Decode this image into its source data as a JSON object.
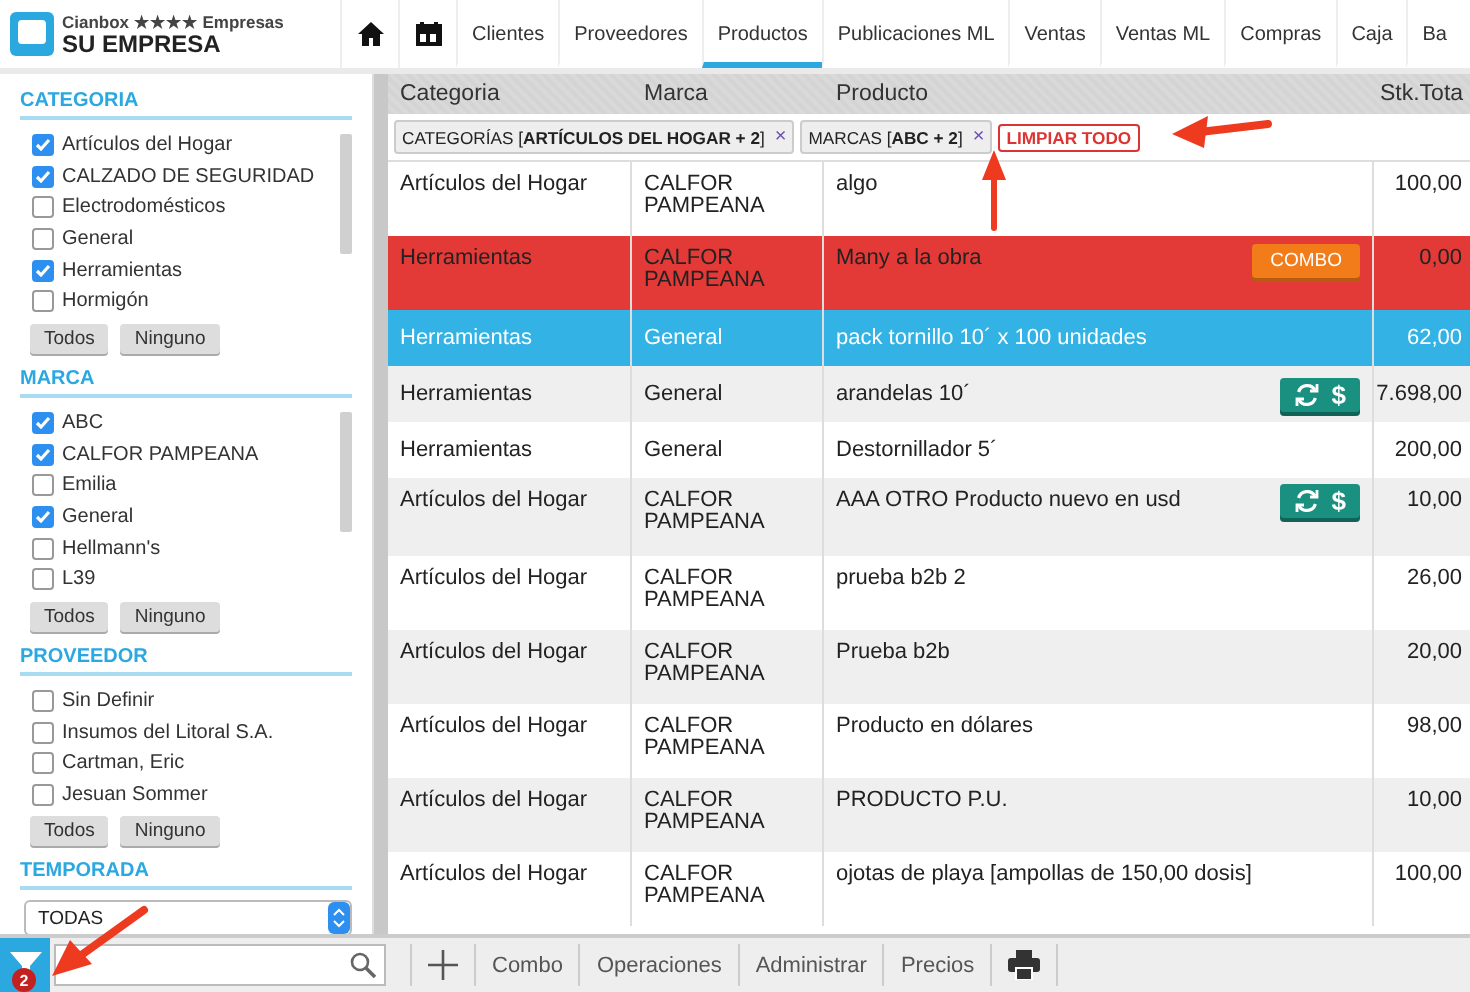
{
  "header": {
    "brand_line": "Cianbox ★★★★ Empresas",
    "company": "SU EMPRESA",
    "tabs": [
      {
        "label": "Clientes",
        "selected": false
      },
      {
        "label": "Proveedores",
        "selected": false
      },
      {
        "label": "Productos",
        "selected": true
      },
      {
        "label": "Publicaciones ML",
        "selected": false
      },
      {
        "label": "Ventas",
        "selected": false
      },
      {
        "label": "Ventas ML",
        "selected": false
      },
      {
        "label": "Compras",
        "selected": false
      },
      {
        "label": "Caja",
        "selected": false
      },
      {
        "label": "Ba",
        "selected": false
      }
    ]
  },
  "sidebar": {
    "sections": [
      {
        "kind": "checklist",
        "title": "CATEGORIA",
        "items": [
          {
            "label": "Artículos del Hogar",
            "checked": true
          },
          {
            "label": "CALZADO DE SEGURIDAD",
            "checked": true
          },
          {
            "label": "Electrodomésticos",
            "checked": false
          },
          {
            "label": "General",
            "checked": false
          },
          {
            "label": "Herramientas",
            "checked": true
          },
          {
            "label": "Hormigón",
            "checked": false
          }
        ],
        "buttons": [
          "Todos",
          "Ninguno"
        ],
        "scrollable": true
      },
      {
        "kind": "checklist",
        "title": "MARCA",
        "items": [
          {
            "label": "ABC",
            "checked": true
          },
          {
            "label": "CALFOR PAMPEANA",
            "checked": true
          },
          {
            "label": "Emilia",
            "checked": false
          },
          {
            "label": "General",
            "checked": true
          },
          {
            "label": "Hellmann's",
            "checked": false
          },
          {
            "label": "L39",
            "checked": false
          }
        ],
        "buttons": [
          "Todos",
          "Ninguno"
        ],
        "scrollable": true
      },
      {
        "kind": "checklist",
        "title": "PROVEEDOR",
        "items": [
          {
            "label": "Sin Definir",
            "checked": false
          },
          {
            "label": "Insumos del Litoral S.A.",
            "checked": false
          },
          {
            "label": "Cartman, Eric",
            "checked": false
          },
          {
            "label": "Jesuan Sommer",
            "checked": false
          }
        ],
        "buttons": [
          "Todos",
          "Ninguno"
        ],
        "scrollable": false
      },
      {
        "kind": "select",
        "title": "TEMPORADA",
        "value": "TODAS"
      }
    ]
  },
  "table": {
    "columns": [
      "Categoria",
      "Marca",
      "Producto",
      "Stk.Tota"
    ],
    "filters": [
      {
        "text": "CATEGORÍAS [**ARTÍCULOS DEL HOGAR + 2**]",
        "remove": "×"
      },
      {
        "text": "MARCAS [**ABC + 2**]",
        "remove": "×"
      }
    ],
    "clear_all": "LIMPIAR TODO",
    "rows": [
      {
        "cells": [
          "Artículos del Hogar",
          "CALFOR PAMPEANA",
          "algo",
          "100,00"
        ],
        "alert": false,
        "selected": false
      },
      {
        "cells": [
          "Herramientas",
          "CALFOR PAMPEANA",
          "Many a la obra",
          "0,00"
        ],
        "alert": true,
        "selected": false,
        "action": {
          "kind": "combo",
          "label": "COMBO"
        }
      },
      {
        "cells": [
          "Herramientas",
          "General",
          "pack tornillo 10´ x 100 unidades",
          "62,00"
        ],
        "alert": false,
        "selected": true
      },
      {
        "cells": [
          "Herramientas",
          "General",
          "arandelas 10´",
          "7.698,00"
        ],
        "alert": false,
        "selected": false,
        "action": {
          "kind": "price",
          "label": "$"
        }
      },
      {
        "cells": [
          "Herramientas",
          "General",
          "Destornillador 5´",
          "200,00"
        ],
        "alert": false,
        "selected": false
      },
      {
        "cells": [
          "Artículos del Hogar",
          "CALFOR PAMPEANA",
          "AAA OTRO Producto nuevo en usd",
          "10,00"
        ],
        "alert": false,
        "selected": false,
        "action": {
          "kind": "price",
          "label": "$"
        }
      },
      {
        "cells": [
          "Artículos del Hogar",
          "CALFOR PAMPEANA",
          "prueba b2b 2",
          "26,00"
        ],
        "alert": false,
        "selected": false
      },
      {
        "cells": [
          "Artículos del Hogar",
          "CALFOR PAMPEANA",
          "Prueba b2b",
          "20,00"
        ],
        "alert": false,
        "selected": false
      },
      {
        "cells": [
          "Artículos del Hogar",
          "CALFOR PAMPEANA",
          "Producto en dólares",
          "98,00"
        ],
        "alert": false,
        "selected": false
      },
      {
        "cells": [
          "Artículos del Hogar",
          "CALFOR PAMPEANA",
          "PRODUCTO P.U.",
          "10,00"
        ],
        "alert": false,
        "selected": false
      },
      {
        "cells": [
          "Artículos del Hogar",
          "CALFOR PAMPEANA",
          "ojotas de playa [ampollas de 150,00 dosis]",
          "100,00"
        ],
        "alert": false,
        "selected": false
      }
    ]
  },
  "footer": {
    "filter_count": "2",
    "actions": [
      "Combo",
      "Operaciones",
      "Administrar",
      "Precios"
    ]
  }
}
